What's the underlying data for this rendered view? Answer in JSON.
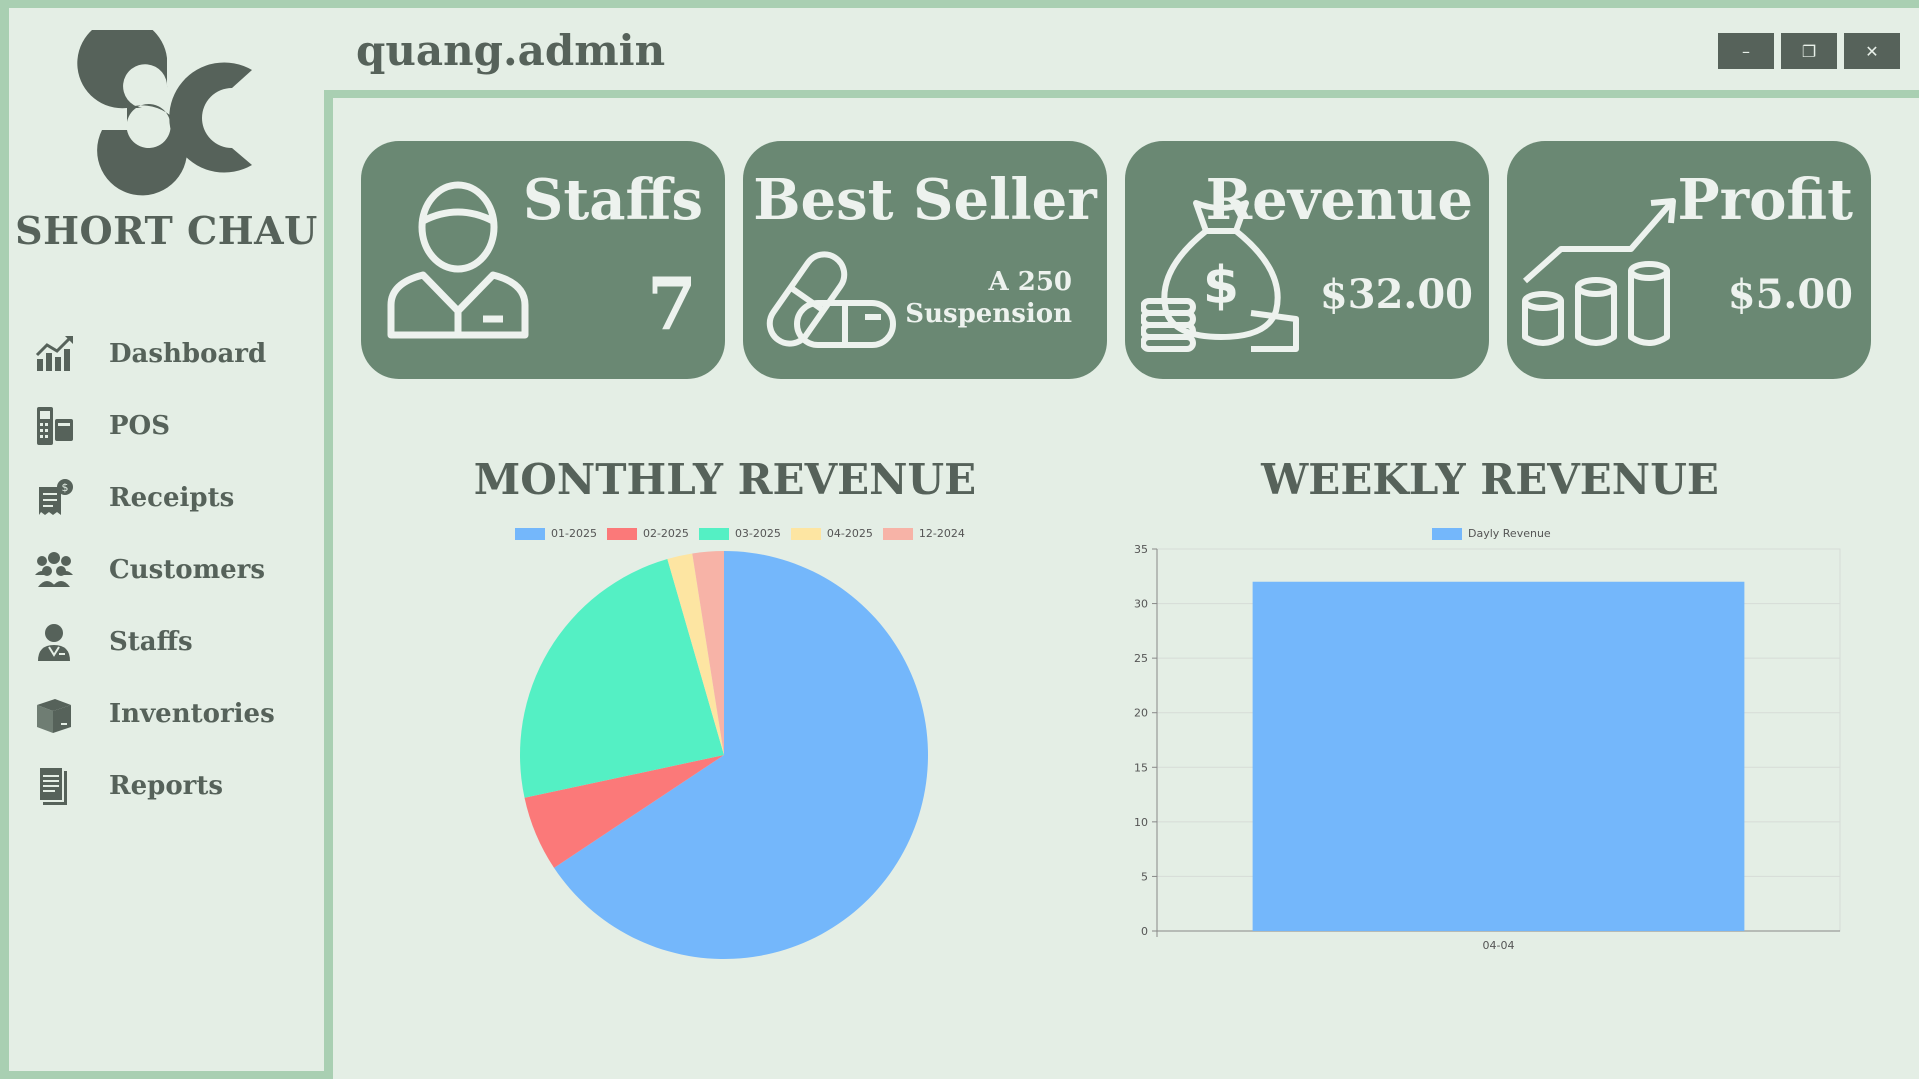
{
  "app": {
    "brand": "SHORT CHAU",
    "username": "quang.admin"
  },
  "window_controls": {
    "minimize_icon": "minimize-icon",
    "restore_icon": "restore-icon",
    "close_icon": "close-icon"
  },
  "sidebar": {
    "items": [
      {
        "label": "Dashboard",
        "icon": "chart-up-icon"
      },
      {
        "label": "POS",
        "icon": "pos-terminal-icon"
      },
      {
        "label": "Receipts",
        "icon": "receipt-icon"
      },
      {
        "label": "Customers",
        "icon": "people-group-icon"
      },
      {
        "label": "Staffs",
        "icon": "staff-icon"
      },
      {
        "label": "Inventories",
        "icon": "box-icon"
      },
      {
        "label": "Reports",
        "icon": "document-icon"
      }
    ]
  },
  "cards": {
    "staffs": {
      "title": "Staffs",
      "value": "7",
      "icon": "person-icon"
    },
    "best_seller": {
      "title": "Best Seller",
      "value_line1": "A 250",
      "value_line2": "Suspension",
      "icon": "pills-icon"
    },
    "revenue": {
      "title": "Revenue",
      "value": "$32.00",
      "icon": "money-bag-icon"
    },
    "profit": {
      "title": "Profit",
      "value": "$5.00",
      "icon": "coins-growth-icon"
    }
  },
  "colors": {
    "accent": "#6a8873",
    "frame": "#a9cfb2",
    "background": "#e4eee5",
    "text": "#56625a"
  },
  "chart_data": [
    {
      "type": "pie",
      "title": "MONTHLY REVENUE",
      "categories": [
        "01-2025",
        "02-2025",
        "03-2025",
        "04-2025",
        "12-2024"
      ],
      "values": [
        66,
        6,
        24,
        2,
        2.5
      ],
      "colors": [
        "#74b7fb",
        "#fb7979",
        "#54f0c4",
        "#fde5a2",
        "#f7b3a7"
      ],
      "legend": "top"
    },
    {
      "type": "bar",
      "title": "WEEKLY REVENUE",
      "categories": [
        "04-04"
      ],
      "series": [
        {
          "name": "Dayly Revenue",
          "values": [
            32
          ]
        }
      ],
      "color": "#74b7fb",
      "ylim": [
        0,
        35
      ],
      "yticks": [
        0,
        5,
        10,
        15,
        20,
        25,
        30,
        35
      ],
      "grid": true,
      "legend": "top"
    }
  ]
}
